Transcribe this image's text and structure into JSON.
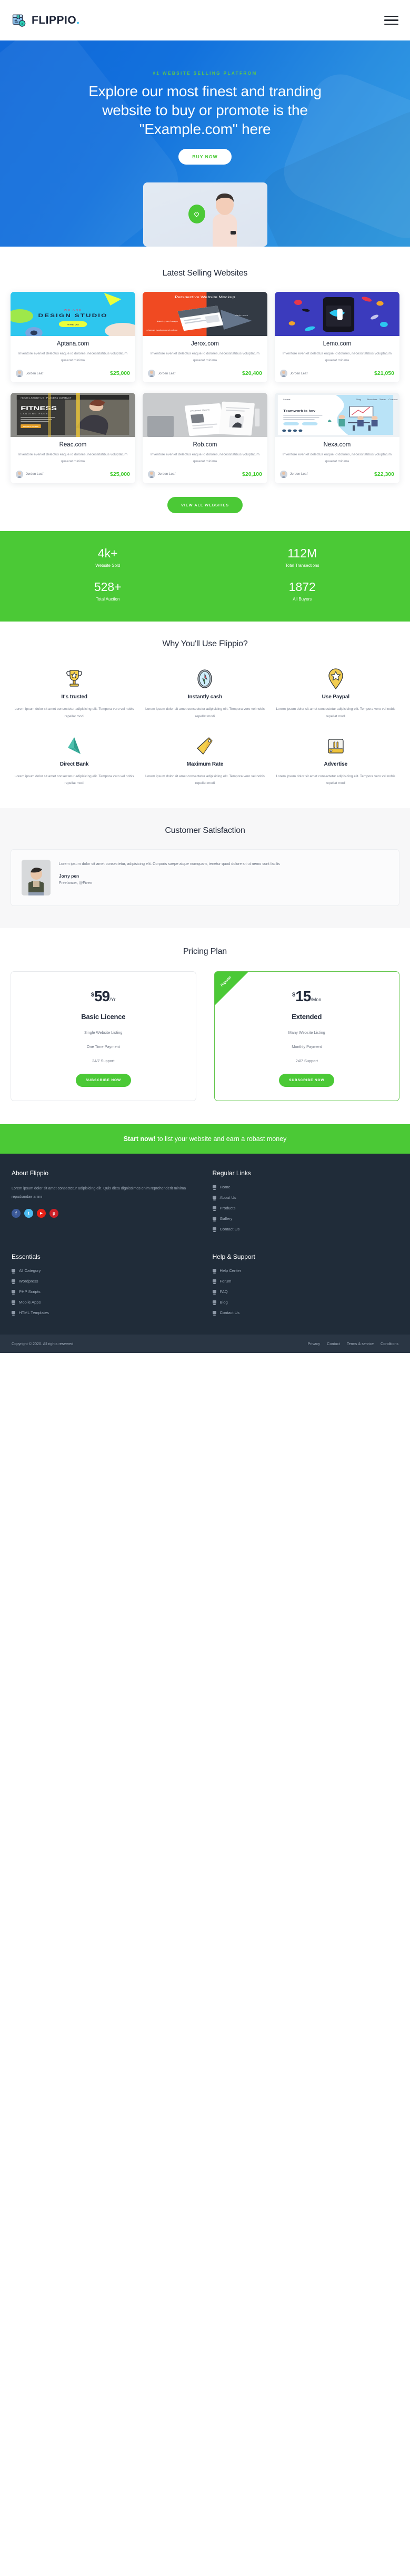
{
  "header": {
    "brand_name": "FLIPPIO",
    "brand_dot": ".",
    "menu_label": "Menu"
  },
  "hero": {
    "eyebrow": "#1 WEBSITE SELLING PLATFROM",
    "title": "Explore our most finest and tranding website to buy or promote is the \"Example.com\" here",
    "cta": "BUY NOW",
    "badge_icon": "heart-icon"
  },
  "listings": {
    "title": "Latest Selling Websites",
    "view_all": "VIEW ALL WEBSITES",
    "cards": [
      {
        "name": "Aptana.com",
        "desc": "Inventore eveniet delectus eaque id dolores, necessitatibus voluptatum quaerat minima",
        "seller": "Jorden Leaf",
        "price": "$25,000",
        "thumb": "design-studio"
      },
      {
        "name": "Jerox.com",
        "desc": "Inventore eveniet delectus eaque id dolores, necessitatibus voluptatum quaerat minima",
        "seller": "Jorden Leaf",
        "price": "$20,400",
        "thumb": "perspective-mockup"
      },
      {
        "name": "Lemo.com",
        "desc": "Inventore eveniet delectus eaque id dolores, necessitatibus voluptatum quaerat minima",
        "seller": "Jorden Leaf",
        "price": "$21,050",
        "thumb": "confetti-phone"
      },
      {
        "name": "Reac.com",
        "desc": "Inventore eveniet delectus eaque id dolores, necessitatibus voluptatum quaerat minima",
        "seller": "Jorden Leaf",
        "price": "$25,000",
        "thumb": "fitness-landing"
      },
      {
        "name": "Rob.com",
        "desc": "Inventore eveniet delectus eaque id dolores, necessitatibus voluptatum quaerat minima",
        "seller": "Jorden Leaf",
        "price": "$20,100",
        "thumb": "grey-screens"
      },
      {
        "name": "Nexa.com",
        "desc": "Inventore eveniet delectus eaque id dolores, necessitatibus voluptatum quaerat minima",
        "seller": "Jorden Leaf",
        "price": "$22,300",
        "thumb": "teamwork-illustration"
      }
    ]
  },
  "stats": {
    "items": [
      {
        "number": "4k+",
        "label": "Website Sold"
      },
      {
        "number": "112M",
        "label": "Total Transections"
      },
      {
        "number": "528+",
        "label": "Total Auction"
      },
      {
        "number": "1872",
        "label": "All Buyers"
      }
    ]
  },
  "features": {
    "title": "Why You'll Use Flippio?",
    "items": [
      {
        "icon": "trophy-icon",
        "title": "It's trusted",
        "text": "Lorem ipsum dolor sit amet consectetur adipisicing elit. Tempora vero vel nobis repellat modi"
      },
      {
        "icon": "compass-icon",
        "title": "Instantly cash",
        "text": "Lorem ipsum dolor sit amet consectetur adipisicing elit. Tempora vero vel nobis repellat modi"
      },
      {
        "icon": "star-badge-icon",
        "title": "Use Paypal",
        "text": "Lorem ipsum dolor sit amet consectetur adipisicing elit. Tempora vero vel nobis repellat modi"
      },
      {
        "icon": "paper-plane-icon",
        "title": "Direct Bank",
        "text": "Lorem ipsum dolor sit amet consectetur adipisicing elit. Tempora vero vel nobis repellat modi"
      },
      {
        "icon": "price-tag-icon",
        "title": "Maximum Rate",
        "text": "Lorem ipsum dolor sit amet consectetur adipisicing elit. Tempora vero vel nobis repellat modi"
      },
      {
        "icon": "billboard-icon",
        "title": "Advertise",
        "text": "Lorem ipsum dolor sit amet consectetur adipisicing elit. Tempora vero vel nobis repellat modi"
      }
    ]
  },
  "testimonials": {
    "title": "Customer Satisfaction",
    "quote": "Lorem ipsum dolor sit amet consectetur, adipisicing elit. Corporis saepe atque numquam, tenetur quod dolore sit ut nemo sunt facilis",
    "author": "Jorry pen",
    "role": "Freelancer, @Fiverr"
  },
  "pricing": {
    "title": "Pricing Plan",
    "plans": [
      {
        "currency": "$",
        "amount": "59",
        "period": "/Yr",
        "name": "Basic Licence",
        "features": [
          "Single Website Listing",
          "One Time Payment",
          "24/7 Support"
        ],
        "cta": "SUBSCRIBE NOW",
        "ribbon": "",
        "popular": false
      },
      {
        "currency": "$",
        "amount": "15",
        "period": "/Mon",
        "name": "Extended",
        "features": [
          "Many Website Listing",
          "Monthly Payment",
          "24/7 Support"
        ],
        "cta": "SUBSCRIBE NOW",
        "ribbon": "Popular",
        "popular": true
      }
    ]
  },
  "cta_bar": {
    "strong": "Start now!",
    "rest": " to list your website and earn a robast money"
  },
  "footer": {
    "about": {
      "title": "About Flippio",
      "text": "Lorem ipsum dolor sit amet consectetur adipisicing elit. Quis dicta dignissimos enim reprehenderit minima repudiandae animi",
      "social": [
        {
          "name": "facebook-icon",
          "glyph": "f",
          "color": "#3b5998"
        },
        {
          "name": "twitter-icon",
          "glyph": "t",
          "color": "#4cbbf0"
        },
        {
          "name": "youtube-icon",
          "glyph": "▶",
          "color": "#e62117"
        },
        {
          "name": "pinterest-icon",
          "glyph": "p",
          "color": "#cb2027"
        }
      ]
    },
    "regular_links": {
      "title": "Regular Links",
      "items": [
        "Home",
        "About Us",
        "Products",
        "Gallery",
        "Contact Us"
      ]
    },
    "essentials": {
      "title": "Essentials",
      "items": [
        "All Category",
        "Wordpress",
        "PHP Scripts",
        "Mobile Apps",
        "HTML Templates"
      ]
    },
    "help_support": {
      "title": "Help & Support",
      "items": [
        "Help Center",
        "Forum",
        "FAQ",
        "Blog",
        "Contact Us"
      ]
    },
    "copyright": "Copyright © 2020. All rights reserved",
    "legal_links": [
      "Privacy",
      "Contact",
      "Terms & service",
      "Conditions"
    ]
  },
  "colors": {
    "brand_blue": "#1068d8",
    "accent_green": "#4bc936",
    "price_green": "#3fcb2c",
    "dark_navy": "#202c39",
    "footer_bar": "#2a3644"
  }
}
